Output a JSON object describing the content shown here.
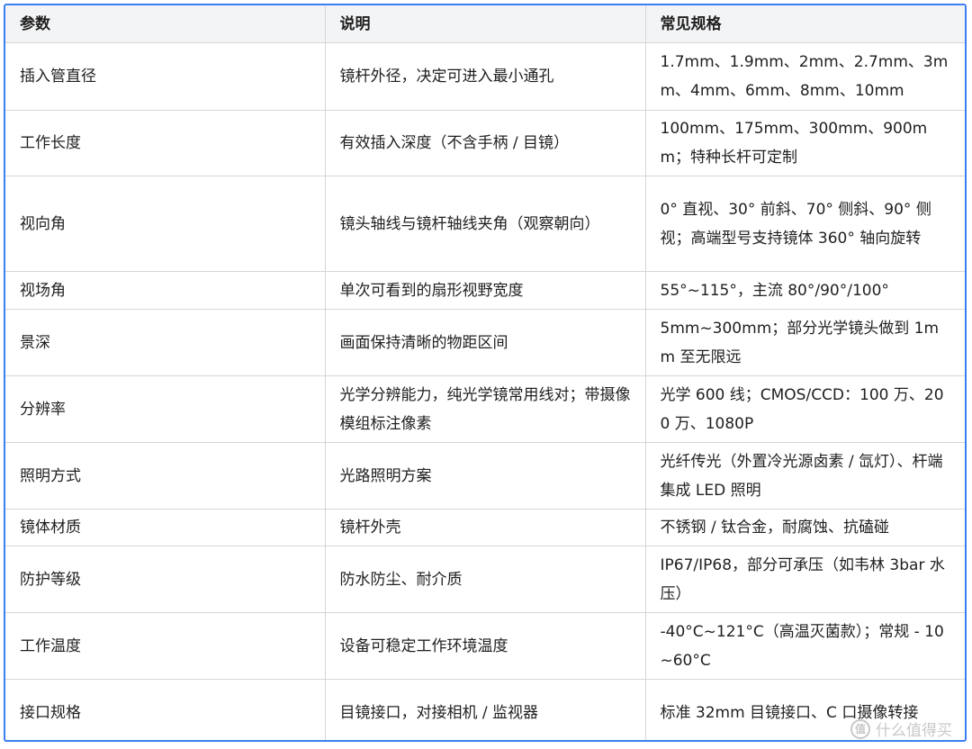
{
  "table": {
    "headers": [
      "参数",
      "说明",
      "常见规格"
    ],
    "rows": [
      [
        "插入管直径",
        "镜杆外径，决定可进入最小通孔",
        "1.7mm、1.9mm、2mm、2.7mm、3mm、4mm、6mm、8mm、10mm"
      ],
      [
        "工作长度",
        "有效插入深度（不含手柄 / 目镜）",
        "100mm、175mm、300mm、900mm；特种长杆可定制"
      ],
      [
        "视向角",
        "镜头轴线与镜杆轴线夹角（观察朝向）",
        "0° 直视、30° 前斜、70° 侧斜、90° 侧视；高端型号支持镜体 360° 轴向旋转"
      ],
      [
        "视场角",
        "单次可看到的扇形视野宽度",
        "55°~115°，主流 80°/90°/100°"
      ],
      [
        "景深",
        "画面保持清晰的物距区间",
        "5mm~300mm；部分光学镜头做到 1mm 至无限远"
      ],
      [
        "分辨率",
        "光学分辨能力，纯光学镜常用线对；带摄像模组标注像素",
        "光学 600 线；CMOS/CCD：100 万、200 万、1080P"
      ],
      [
        "照明方式",
        "光路照明方案",
        "光纤传光（外置冷光源卤素 / 氙灯）、杆端集成 LED 照明"
      ],
      [
        "镜体材质",
        "镜杆外壳",
        "不锈钢 / 钛合金，耐腐蚀、抗磕碰"
      ],
      [
        "防护等级",
        "防水防尘、耐介质",
        "IP67/IP68，部分可承压（如韦林 3bar 水压）"
      ],
      [
        "工作温度",
        "设备可稳定工作环境温度",
        "-40°C~121°C（高温灭菌款）；常规 - 10~60°C"
      ],
      [
        "接口规格",
        "目镜接口，对接相机 / 监视器",
        "标准 32mm 目镜接口、C 口摄像转接"
      ]
    ]
  },
  "watermark": {
    "icon": "zhi-icon",
    "badge": "值",
    "text": "什么值得买"
  }
}
